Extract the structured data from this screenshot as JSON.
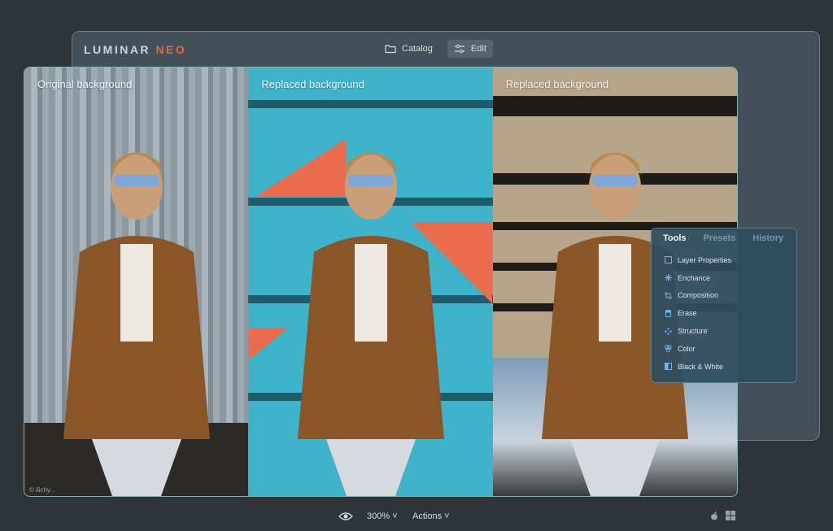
{
  "app": {
    "logo_part1": "LUMINAR",
    "logo_part2": "NEO"
  },
  "nav": {
    "catalog_label": "Catalog",
    "edit_label": "Edit",
    "active": "Edit"
  },
  "panels": [
    {
      "label": "Original background"
    },
    {
      "label": "Replaced background"
    },
    {
      "label": "Replaced background"
    }
  ],
  "credit": "© ilichy...",
  "tools_panel": {
    "tabs": [
      "Tools",
      "Presets",
      "History"
    ],
    "active_tab": "Tools",
    "items": [
      {
        "label": "Layer Properties",
        "icon": "layer-properties-icon"
      },
      {
        "label": "Enchance",
        "icon": "sparkle-icon"
      },
      {
        "label": "Composition",
        "icon": "crop-icon"
      },
      {
        "label": "Erase",
        "icon": "eraser-icon"
      },
      {
        "label": "Structure",
        "icon": "structure-icon"
      },
      {
        "label": "Color",
        "icon": "color-icon"
      },
      {
        "label": "Black & White",
        "icon": "black-white-icon"
      }
    ]
  },
  "bottombar": {
    "zoom": "300%",
    "actions": "Actions"
  },
  "colors": {
    "accent": "#e06a3c",
    "frame": "#7fb4b0",
    "panel": "#2f4e5f"
  }
}
